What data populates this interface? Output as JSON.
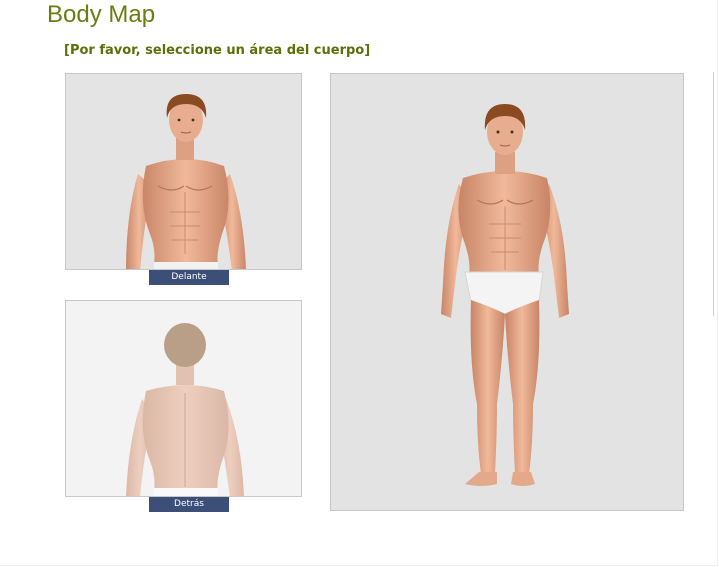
{
  "page": {
    "title": "Body Map",
    "instruction": "[Por favor, seleccione un área del cuerpo]"
  },
  "views": {
    "front_label": "Delante",
    "back_label": "Detrás"
  },
  "colors": {
    "title": "#6b7d12",
    "instruction": "#5d6f0a",
    "label_bg": "#3b4f79",
    "panel_bg": "#e4e4e4",
    "skin": "#e0a888",
    "hair": "#8a4a22"
  }
}
